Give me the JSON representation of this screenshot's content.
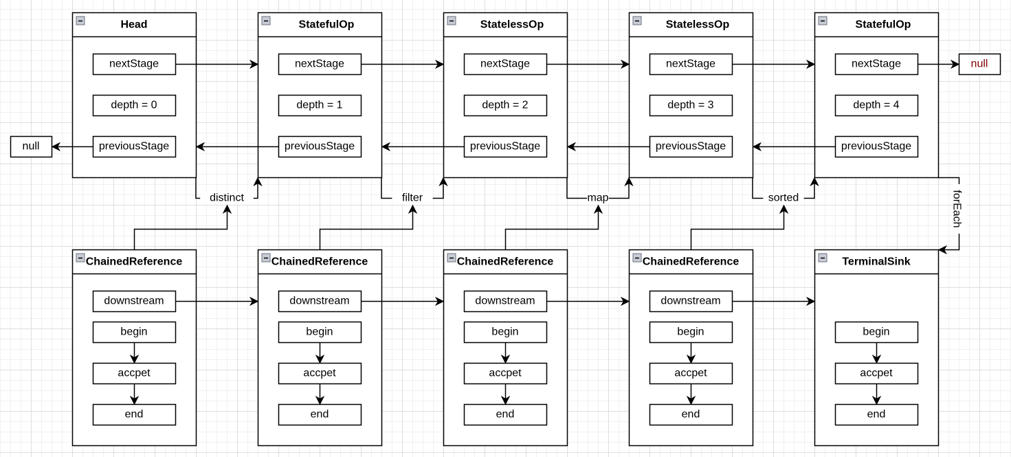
{
  "pipeline": [
    {
      "title": "Head",
      "next": "nextStage",
      "depth": "depth = 0",
      "prev": "previousStage"
    },
    {
      "title": "StatefulOp",
      "next": "nextStage",
      "depth": "depth = 1",
      "prev": "previousStage"
    },
    {
      "title": "StatelessOp",
      "next": "nextStage",
      "depth": "depth = 2",
      "prev": "previousStage"
    },
    {
      "title": "StatelessOp",
      "next": "nextStage",
      "depth": "depth = 3",
      "prev": "previousStage"
    },
    {
      "title": "StatefulOp",
      "next": "nextStage",
      "depth": "depth = 4",
      "prev": "previousStage"
    }
  ],
  "operations": [
    "distinct",
    "filter",
    "map",
    "sorted"
  ],
  "terminal_operation": "forEach",
  "null_left": "null",
  "null_right": "null",
  "sinks": [
    {
      "title": "ChainedReference",
      "downstream": "downstream",
      "begin": "begin",
      "accept": "accpet",
      "end": "end"
    },
    {
      "title": "ChainedReference",
      "downstream": "downstream",
      "begin": "begin",
      "accept": "accpet",
      "end": "end"
    },
    {
      "title": "ChainedReference",
      "downstream": "downstream",
      "begin": "begin",
      "accept": "accpet",
      "end": "end"
    },
    {
      "title": "ChainedReference",
      "downstream": "downstream",
      "begin": "begin",
      "accept": "accpet",
      "end": "end"
    },
    {
      "title": "TerminalSink",
      "begin": "begin",
      "accept": "accpet",
      "end": "end"
    }
  ],
  "colors": {
    "stroke": "#000000",
    "null_right_text": "#7f0000",
    "collapse_icon": "#a0a8b8"
  }
}
